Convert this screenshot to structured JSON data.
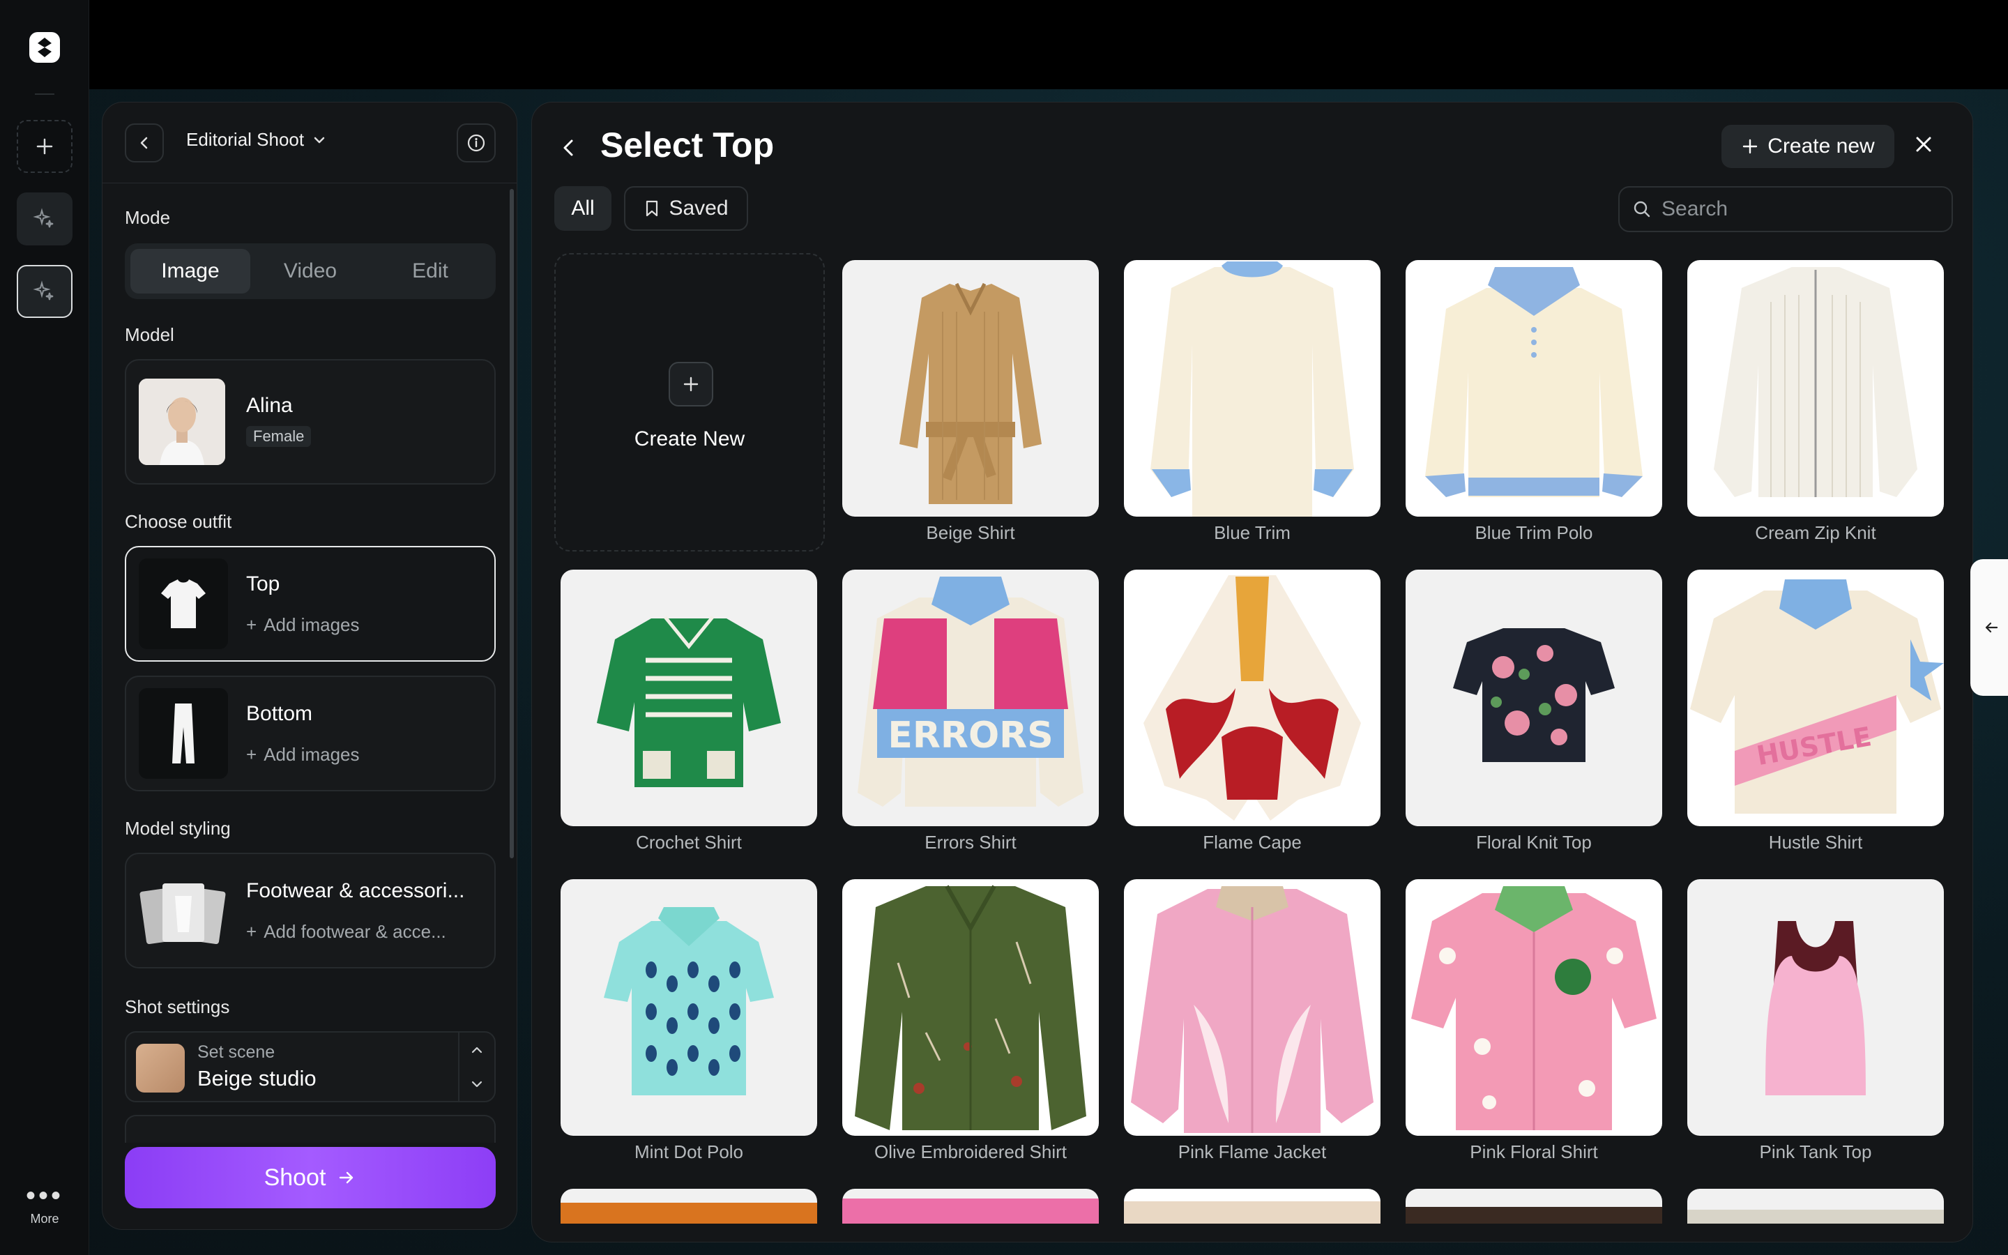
{
  "rail": {
    "more_label": "More"
  },
  "panel": {
    "title": "Editorial Shoot",
    "mode_label": "Mode",
    "modes": [
      "Image",
      "Video",
      "Edit"
    ],
    "model_label": "Model",
    "model": {
      "name": "Alina",
      "badge": "Female"
    },
    "outfit_label": "Choose outfit",
    "outfit": [
      {
        "name": "Top",
        "action": "Add images"
      },
      {
        "name": "Bottom",
        "action": "Add images"
      }
    ],
    "styling_label": "Model styling",
    "styling": {
      "name": "Footwear & accessori...",
      "action": "Add footwear & acce..."
    },
    "shot_label": "Shot settings",
    "scene": {
      "key": "Set scene",
      "value": "Beige studio"
    },
    "shoot_label": "Shoot"
  },
  "main": {
    "title": "Select Top",
    "create_label": "Create new",
    "filters": {
      "all": "All",
      "saved": "Saved"
    },
    "search_placeholder": "Search",
    "create_tile_label": "Create New",
    "items": [
      "Beige Shirt",
      "Blue Trim",
      "Blue Trim Polo",
      "Cream Zip Knit",
      "Crochet Shirt",
      "Errors Shirt",
      "Flame Cape",
      "Floral Knit Top",
      "Hustle Shirt",
      "Mint Dot Polo",
      "Olive Embroidered Shirt",
      "Pink Flame Jacket",
      "Pink Floral Shirt",
      "Pink Tank Top"
    ]
  }
}
